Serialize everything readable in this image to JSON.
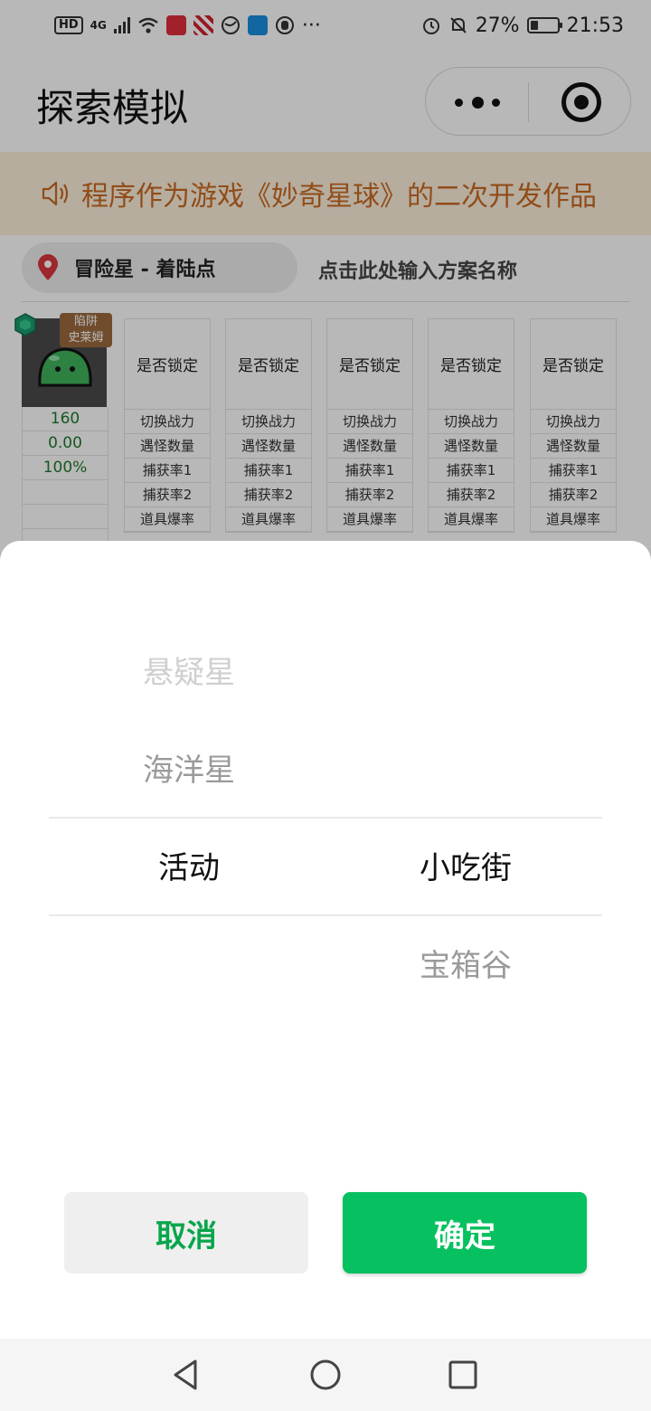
{
  "status_bar": {
    "hd": "HD",
    "network": "4G",
    "more": "···",
    "battery": "27%",
    "time": "21:53"
  },
  "nav_bar": {
    "title": "探索模拟"
  },
  "notice": {
    "text": "程序作为游戏《妙奇星球》的二次开发作品"
  },
  "location": {
    "label": "冒险星 - 着陆点",
    "plan_placeholder": "点击此处输入方案名称"
  },
  "pet": {
    "badge_line1": "陷阱",
    "badge_line2": "史莱姆",
    "stats": [
      "160",
      "0.00",
      "100%",
      "",
      "",
      ""
    ]
  },
  "columns": {
    "head": "是否锁定",
    "rows": [
      "切换战力",
      "遇怪数量",
      "捕获率1",
      "捕获率2",
      "道具爆率"
    ]
  },
  "picker": {
    "left_column": [
      {
        "label": "悬疑星",
        "state": "faint"
      },
      {
        "label": "海洋星",
        "state": "near"
      },
      {
        "label": "活动",
        "state": "selected"
      }
    ],
    "right_column": [
      {
        "label": "小吃街",
        "state": "selected"
      },
      {
        "label": "宝箱谷",
        "state": "near"
      }
    ],
    "cancel_label": "取消",
    "confirm_label": "确定"
  },
  "colors": {
    "accent_green": "#07c160",
    "notice_text": "#c96a22",
    "notice_bg": "#fdf0dd",
    "stat_green": "#1f7a2c",
    "location_pin": "#d9363e"
  },
  "icons": [
    "speaker-icon",
    "location-pin-icon",
    "more-icon",
    "close-icon",
    "back-icon",
    "home-icon",
    "recents-icon"
  ]
}
